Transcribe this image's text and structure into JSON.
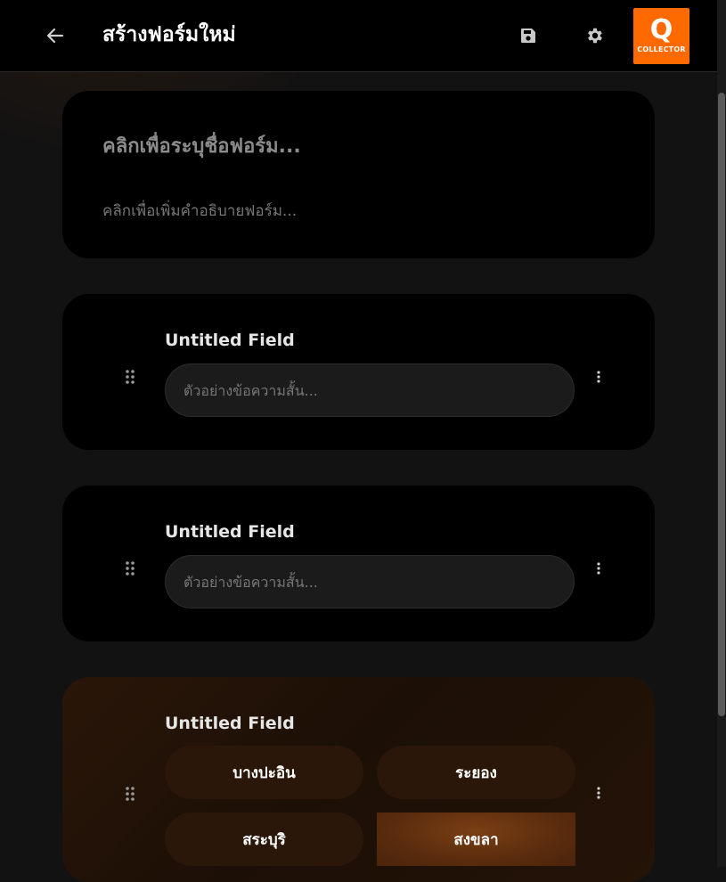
{
  "header": {
    "title": "สร้างฟอร์มใหม่",
    "logo": {
      "letter": "Q",
      "text": "COLLECTOR",
      "color": "#ff6a00"
    }
  },
  "form": {
    "title_placeholder": "คลิกเพื่อระบุชื่อฟอร์ม...",
    "description_placeholder": "คลิกเพื่อเพิ่มคำอธิบายฟอร์ม..."
  },
  "fields": [
    {
      "label": "Untitled Field",
      "placeholder": "ตัวอย่างข้อความสั้น..."
    },
    {
      "label": "Untitled Field",
      "placeholder": "ตัวอย่างข้อความสั้น..."
    },
    {
      "label": "Untitled Field",
      "options": [
        "บางปะอิน",
        "ระยอง",
        "สระบุริ",
        "สงขลา"
      ],
      "selected": "สงขลา"
    }
  ],
  "icons": [
    "arrow-left-icon",
    "save-icon",
    "gear-icon",
    "drag-handle-icon",
    "more-vertical-icon"
  ]
}
